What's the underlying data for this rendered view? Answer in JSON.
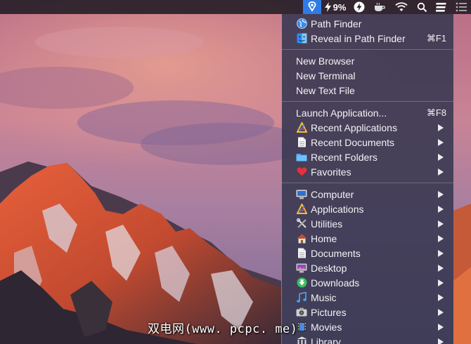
{
  "menubar": {
    "battery_percent": "9%"
  },
  "menu": {
    "section1": [
      {
        "label": "Path Finder",
        "icon": "globe-icon",
        "shortcut": ""
      },
      {
        "label": "Reveal in Path Finder",
        "icon": "finder-icon",
        "shortcut": "⌘F1"
      }
    ],
    "section2": [
      {
        "label": "New Browser"
      },
      {
        "label": "New Terminal"
      },
      {
        "label": "New Text File"
      }
    ],
    "section3": [
      {
        "label": "Launch Application...",
        "shortcut": "⌘F8"
      },
      {
        "label": "Recent Applications",
        "icon": "applications-icon"
      },
      {
        "label": "Recent Documents",
        "icon": "document-icon"
      },
      {
        "label": "Recent Folders",
        "icon": "folder-icon"
      },
      {
        "label": "Favorites",
        "icon": "heart-icon"
      }
    ],
    "section4": [
      {
        "label": "Computer",
        "icon": "computer-icon"
      },
      {
        "label": "Applications",
        "icon": "applications-icon"
      },
      {
        "label": "Utilities",
        "icon": "utilities-icon"
      },
      {
        "label": "Home",
        "icon": "home-icon"
      },
      {
        "label": "Documents",
        "icon": "document-icon"
      },
      {
        "label": "Desktop",
        "icon": "desktop-icon"
      },
      {
        "label": "Downloads",
        "icon": "downloads-icon"
      },
      {
        "label": "Music",
        "icon": "music-icon"
      },
      {
        "label": "Pictures",
        "icon": "pictures-icon"
      },
      {
        "label": "Movies",
        "icon": "movies-icon"
      },
      {
        "label": "Library",
        "icon": "library-icon"
      }
    ]
  },
  "watermark": "双电网(www. pcpc. me)",
  "colors": {
    "menu_bg": "#3a3852",
    "menubar_highlight": "#2f7be6",
    "text": "#f2f2f4"
  }
}
